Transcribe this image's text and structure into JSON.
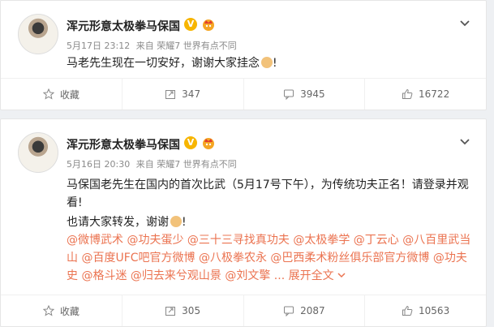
{
  "posts": [
    {
      "author": "浑元形意太极拳马保国",
      "verified_badge": "V",
      "date": "5月17日 23:12",
      "source": "来自 荣耀7 世界有点不同",
      "text": "马老先生现在一切安好，谢谢大家挂念",
      "text_end": "!",
      "actions": {
        "fav": "收藏",
        "repost": "347",
        "comment": "3945",
        "like": "16722"
      }
    },
    {
      "author": "浑元形意太极拳马保国",
      "verified_badge": "V",
      "date": "5月16日 20:30",
      "source": "来自 荣耀7 世界有点不同",
      "line1": "马保国老先生在国内的首次比武（5月17号下午），为传统功夫正名！请登录并观",
      "line2": "看!",
      "line3": "也请大家转发，谢谢",
      "line3_end": "!",
      "mentions_line1": "@微博武术 @功夫蛋少 @三十三寻找真功夫 @太极拳学 @丁云心 @八百里武当",
      "mentions_line2": "山 @百度UFC吧官方微博 @八极拳农永 @巴西柔术粉丝俱乐部官方微博 @功夫",
      "mentions_line3": "史 @格斗迷 @归去来兮观山景 @刘文擎 ...",
      "expand": "展开全文",
      "actions": {
        "fav": "收藏",
        "repost": "305",
        "comment": "2087",
        "like": "10563"
      }
    }
  ],
  "colors": {
    "mention": "#eb7350",
    "badge": "#f7b500",
    "background": "#eef0f3"
  }
}
